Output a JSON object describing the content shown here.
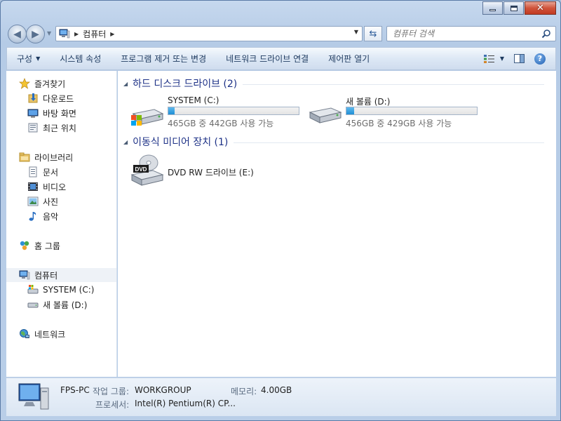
{
  "window": {
    "controls": {
      "minimize_icon": "minimize-icon",
      "maximize_icon": "maximize-icon",
      "close_icon": "close-icon"
    }
  },
  "address": {
    "crumb": "컴퓨터",
    "search_placeholder": "컴퓨터 검색"
  },
  "toolbar": {
    "items": [
      {
        "label": "구성",
        "dropdown": true
      },
      {
        "label": "시스템 속성"
      },
      {
        "label": "프로그램 제거 또는 변경"
      },
      {
        "label": "네트워크 드라이브 연결"
      },
      {
        "label": "제어판 열기"
      }
    ]
  },
  "sidebar": {
    "favorites": {
      "label": "즐겨찾기",
      "items": [
        "다운로드",
        "바탕 화면",
        "최근 위치"
      ]
    },
    "libraries": {
      "label": "라이브러리",
      "items": [
        "문서",
        "비디오",
        "사진",
        "음악"
      ]
    },
    "homegroup": {
      "label": "홈 그룹"
    },
    "computer": {
      "label": "컴퓨터",
      "items": [
        "SYSTEM (C:)",
        "새 볼륨 (D:)"
      ]
    },
    "network": {
      "label": "네트워크"
    }
  },
  "content": {
    "hdd_group": "하드 디스크 드라이브 (2)",
    "removable_group": "이동식 미디어 장치 (1)",
    "drives": [
      {
        "name": "SYSTEM (C:)",
        "space": "465GB 중 442GB 사용 가능",
        "used_fraction": 0.05
      },
      {
        "name": "새 볼륨 (D:)",
        "space": "456GB 중 429GB 사용 가능",
        "used_fraction": 0.06
      }
    ],
    "dvd": {
      "name": "DVD RW 드라이브 (E:)",
      "badge": "DVD"
    }
  },
  "details": {
    "name": "FPS-PC",
    "workgroup_label": "작업 그룹:",
    "workgroup": "WORKGROUP",
    "memory_label": "메모리:",
    "memory": "4.00GB",
    "cpu_label": "프로세서:",
    "cpu": "Intel(R) Pentium(R) CP..."
  },
  "colors": {
    "group_title": "#1e3287",
    "bar_fill": "#1f8fd6",
    "close_button": "#c23a22"
  }
}
